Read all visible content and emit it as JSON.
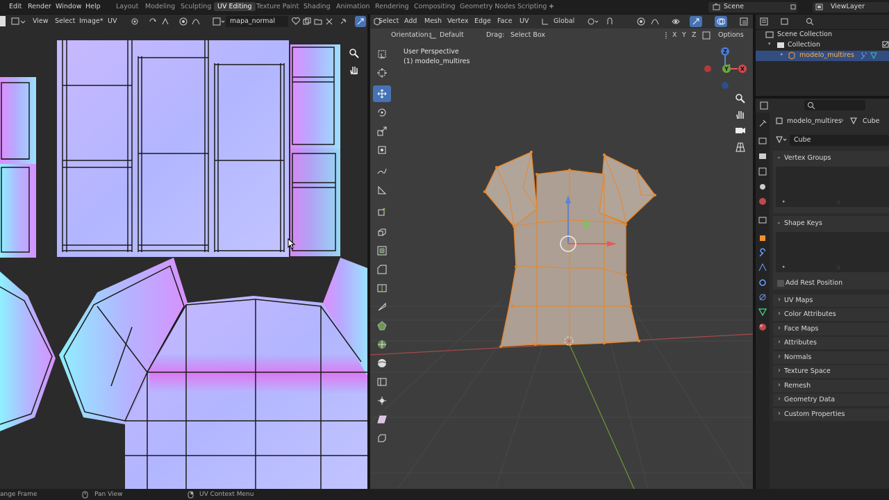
{
  "menubar": {
    "items": [
      "Edit",
      "Render",
      "Window",
      "Help"
    ],
    "workspaces": [
      "Layout",
      "Modeling",
      "Sculpting",
      "UV Editing",
      "Texture Paint",
      "Shading",
      "Animation",
      "Rendering",
      "Compositing",
      "Geometry Nodes",
      "Scripting",
      "+"
    ],
    "active_workspace": "UV Editing",
    "scene": "Scene",
    "view_layer": "ViewLayer"
  },
  "uv_editor": {
    "menus": [
      "View",
      "Select",
      "Image*",
      "UV"
    ],
    "image_name": "mapa_normal"
  },
  "viewport": {
    "menus": [
      "Select",
      "Add",
      "Mesh",
      "Vertex",
      "Edge",
      "Face",
      "UV"
    ],
    "transform_orientation": "Global",
    "orientation_label": "Orientation:",
    "orientation_value": "Default",
    "drag_label": "Drag:",
    "drag_value": "Select Box",
    "options_label": "Options",
    "axes": [
      "X",
      "Y",
      "Z"
    ],
    "overlay_title": "User Perspective",
    "overlay_object": "(1) modelo_multires",
    "gizmo_labels": [
      "Z",
      "Y",
      "X"
    ]
  },
  "outliner": {
    "items": [
      "Scene Collection",
      "Collection",
      "modelo_multires"
    ]
  },
  "properties": {
    "breadcrumb_object": "modelo_multires",
    "breadcrumb_mesh": "Cube",
    "mesh_name": "Cube",
    "panels": {
      "vertex_groups": "Vertex Groups",
      "shape_keys": "Shape Keys",
      "add_rest_position": "Add Rest Position"
    },
    "collapsed_panels": [
      "UV Maps",
      "Color Attributes",
      "Face Maps",
      "Attributes",
      "Normals",
      "Texture Space",
      "Remesh",
      "Geometry Data",
      "Custom Properties"
    ]
  },
  "statusbar": {
    "left": "ange Frame",
    "pan": "Pan View",
    "context": "UV Context Menu"
  },
  "colors": {
    "accent": "#4772b3",
    "selection_orange": "#e8872a",
    "normal_map_base": "#b6b6ff"
  }
}
